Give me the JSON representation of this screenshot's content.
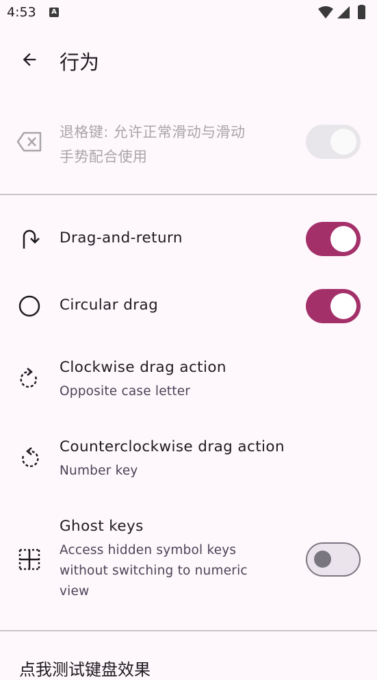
{
  "status_bar": {
    "time": "4:53",
    "notification_icon": "a-letter-icon",
    "indicators": [
      "wifi-icon",
      "signal-icon",
      "battery-icon"
    ]
  },
  "header": {
    "title": "行为",
    "back_icon": "arrow-back-icon"
  },
  "settings": [
    {
      "title": "退格键: 允许正常滑动与滑动",
      "title_line2": "手势配合使用",
      "icon": "backspace-icon",
      "switch": "on",
      "enabled": false
    },
    {
      "title": "Drag-and-return",
      "icon": "u-turn-icon",
      "switch": "on",
      "enabled": true
    },
    {
      "title": "Circular drag",
      "icon": "circle-icon",
      "switch": "on",
      "enabled": true
    },
    {
      "title": "Clockwise drag action",
      "summary": "Opposite case letter",
      "icon": "rotate-clockwise-icon"
    },
    {
      "title": "Counterclockwise drag action",
      "summary": "Number key",
      "icon": "rotate-counterclockwise-icon"
    },
    {
      "title": "Ghost keys",
      "summary_lines": [
        "Access hidden symbol keys",
        "without switching to numeric",
        "view"
      ],
      "icon": "grid-dashed-icon",
      "switch": "off",
      "enabled": true
    }
  ],
  "bottom_partial_text": "点我测试键盘效果",
  "colors": {
    "accent": "#a4306a",
    "background": "#fef7fb",
    "text": "#1d1b20",
    "secondary_text": "#4a4458",
    "disabled": "#a8a6aa"
  }
}
